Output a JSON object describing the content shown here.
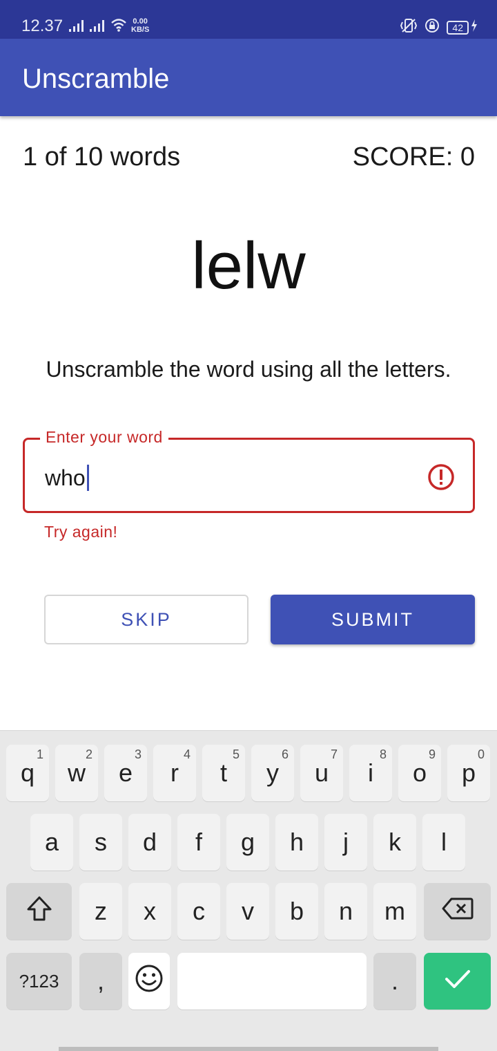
{
  "status_bar": {
    "time": "12.37",
    "net_speed_value": "0.00",
    "net_speed_unit": "KB/S",
    "battery": "42"
  },
  "app_bar": {
    "title": "Unscramble"
  },
  "game": {
    "word_count": "1 of 10 words",
    "score": "SCORE: 0",
    "scrambled_word": "lelw",
    "instructions": "Unscramble the word using all the letters."
  },
  "input": {
    "label": "Enter your word",
    "value": "who",
    "error": "Try again!"
  },
  "buttons": {
    "skip": "SKIP",
    "submit": "SUBMIT"
  },
  "keyboard": {
    "row1": [
      {
        "key": "q",
        "hint": "1"
      },
      {
        "key": "w",
        "hint": "2"
      },
      {
        "key": "e",
        "hint": "3"
      },
      {
        "key": "r",
        "hint": "4"
      },
      {
        "key": "t",
        "hint": "5"
      },
      {
        "key": "y",
        "hint": "6"
      },
      {
        "key": "u",
        "hint": "7"
      },
      {
        "key": "i",
        "hint": "8"
      },
      {
        "key": "o",
        "hint": "9"
      },
      {
        "key": "p",
        "hint": "0"
      }
    ],
    "row2": [
      "a",
      "s",
      "d",
      "f",
      "g",
      "h",
      "j",
      "k",
      "l"
    ],
    "row3": [
      "z",
      "x",
      "c",
      "v",
      "b",
      "n",
      "m"
    ],
    "symbols_label": "?123",
    "comma": ",",
    "period": "."
  },
  "colors": {
    "primary": "#3f51b5",
    "status_bar": "#2c3796",
    "error": "#c62828",
    "enter_key": "#2fc380"
  }
}
